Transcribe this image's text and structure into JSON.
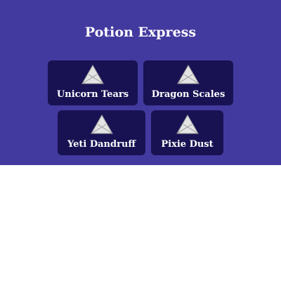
{
  "header": {
    "title": "Potion Express"
  },
  "products": [
    {
      "label": "Unicorn Tears",
      "icon": "broken-image-icon"
    },
    {
      "label": "Dragon Scales",
      "icon": "broken-image-icon"
    },
    {
      "label": "Yeti Dandruff",
      "icon": "broken-image-icon"
    },
    {
      "label": "Pixie Dust",
      "icon": "broken-image-icon"
    }
  ],
  "colors": {
    "banner": "#433a9f",
    "card": "#181253",
    "text": "#ffffff",
    "page_background": "#ffffff"
  }
}
